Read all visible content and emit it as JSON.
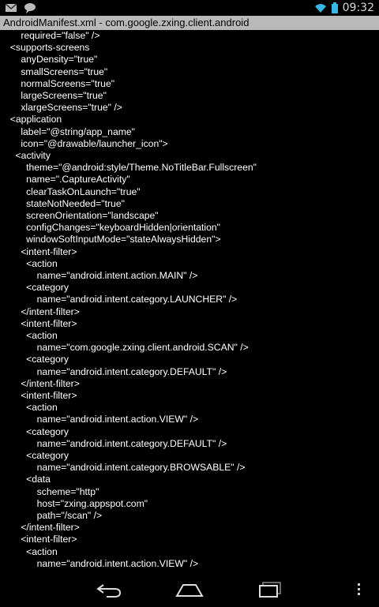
{
  "status_bar": {
    "time": "09:32",
    "left_icons": [
      "mail-icon",
      "bubble-icon"
    ],
    "right_icons": [
      "wifi-icon",
      "battery-icon"
    ]
  },
  "title": "AndroidManifest.xml - com.google.zxing.client.android",
  "code_lines": [
    "      required=\"false\" />",
    "  <supports-screens",
    "      anyDensity=\"true\"",
    "      smallScreens=\"true\"",
    "      normalScreens=\"true\"",
    "      largeScreens=\"true\"",
    "      xlargeScreens=\"true\" />",
    "  <application",
    "      label=\"@string/app_name\"",
    "      icon=\"@drawable/launcher_icon\">",
    "    <activity",
    "        theme=\"@android:style/Theme.NoTitleBar.Fullscreen\"",
    "        name=\".CaptureActivity\"",
    "        clearTaskOnLaunch=\"true\"",
    "        stateNotNeeded=\"true\"",
    "        screenOrientation=\"landscape\"",
    "        configChanges=\"keyboardHidden|orientation\"",
    "        windowSoftInputMode=\"stateAlwaysHidden\">",
    "      <intent-filter>",
    "        <action",
    "            name=\"android.intent.action.MAIN\" />",
    "        <category",
    "            name=\"android.intent.category.LAUNCHER\" />",
    "      </intent-filter>",
    "      <intent-filter>",
    "        <action",
    "            name=\"com.google.zxing.client.android.SCAN\" />",
    "        <category",
    "            name=\"android.intent.category.DEFAULT\" />",
    "      </intent-filter>",
    "      <intent-filter>",
    "        <action",
    "            name=\"android.intent.action.VIEW\" />",
    "        <category",
    "            name=\"android.intent.category.DEFAULT\" />",
    "        <category",
    "            name=\"android.intent.category.BROWSABLE\" />",
    "        <data",
    "            scheme=\"http\"",
    "            host=\"zxing.appspot.com\"",
    "            path=\"/scan\" />",
    "      </intent-filter>",
    "      <intent-filter>",
    "        <action",
    "            name=\"android.intent.action.VIEW\" />"
  ],
  "nav_bar": {
    "buttons": [
      "back-icon",
      "home-icon",
      "recent-apps-icon",
      "menu-icon"
    ]
  }
}
